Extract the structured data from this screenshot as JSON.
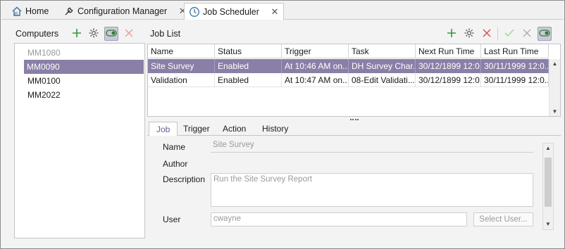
{
  "tabs": [
    {
      "label": "Home",
      "icon": "home-icon"
    },
    {
      "label": "Configuration Manager",
      "icon": "wrench-icon",
      "close": "✕"
    },
    {
      "label": "Job Scheduler",
      "icon": "clock-icon",
      "close": "✕",
      "active": true
    }
  ],
  "computers": {
    "title": "Computers",
    "items": [
      {
        "label": "MM1080",
        "state": "disabled"
      },
      {
        "label": "MM0090",
        "state": "selected"
      },
      {
        "label": "MM0100",
        "state": "normal"
      },
      {
        "label": "MM2022",
        "state": "normal"
      }
    ]
  },
  "job_list": {
    "title": "Job List",
    "columns": [
      "Name",
      "Status",
      "Trigger",
      "Task",
      "Next Run Time",
      "Last Run Time"
    ],
    "rows": [
      [
        "Site Survey",
        "Enabled",
        "At 10:46 AM on...",
        "DH Survey Char...",
        "30/12/1899 12:0...",
        "30/11/1999 12:0..."
      ],
      [
        "Validation",
        "Enabled",
        "At 10:47 AM on...",
        "08-Edit Validati...",
        "30/12/1899 12:0...",
        "30/11/1999 12:0..."
      ]
    ]
  },
  "detail_tabs": [
    "Job",
    "Trigger",
    "Action",
    "History"
  ],
  "job_detail": {
    "name_label": "Name",
    "name_value": "Site Survey",
    "author_label": "Author",
    "description_label": "Description",
    "description_value": "Run the Site Survey Report",
    "user_label": "User",
    "user_value": "cwayne",
    "select_user_label": "Select User..."
  },
  "colors": {
    "accent": "#8a7fa6",
    "add_green": "#2e9b3a",
    "delete_red": "#d9534f"
  }
}
